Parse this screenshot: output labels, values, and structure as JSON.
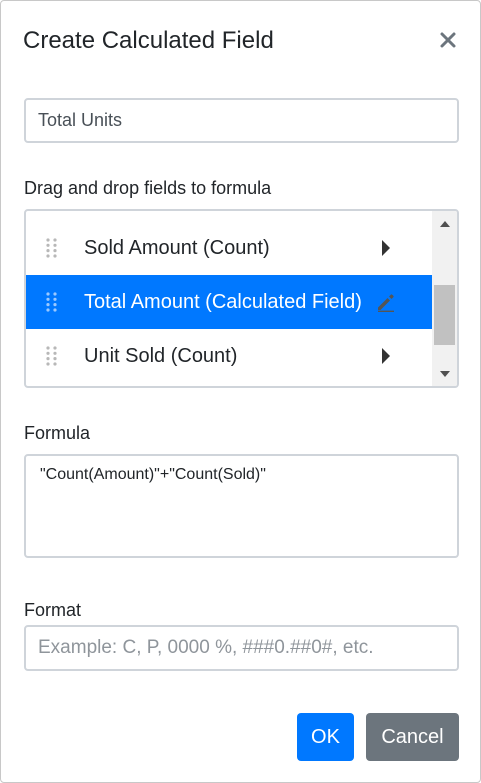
{
  "dialog": {
    "title": "Create Calculated Field",
    "close_icon": "close-icon"
  },
  "name_field": {
    "value": "Total Units"
  },
  "fields_section": {
    "label": "Drag and drop fields to formula",
    "items": [
      {
        "label": "Sold Amount (Count)",
        "icon": "caret-right-icon",
        "selected": false
      },
      {
        "label": "Total Amount (Calculated Field)",
        "icon": "edit-pencil-icon",
        "selected": true
      },
      {
        "label": "Unit Sold (Count)",
        "icon": "caret-right-icon",
        "selected": false
      }
    ]
  },
  "formula_section": {
    "label": "Formula",
    "value": "\"Count(Amount)\"+\"Count(Sold)\""
  },
  "format_section": {
    "label": "Format",
    "placeholder": "Example: C, P, 0000 %, ###0.##0#, etc."
  },
  "buttons": {
    "ok": "OK",
    "cancel": "Cancel"
  },
  "colors": {
    "accent": "#0078ff",
    "secondary_button": "#6c757d",
    "border": "#cfd4da"
  }
}
